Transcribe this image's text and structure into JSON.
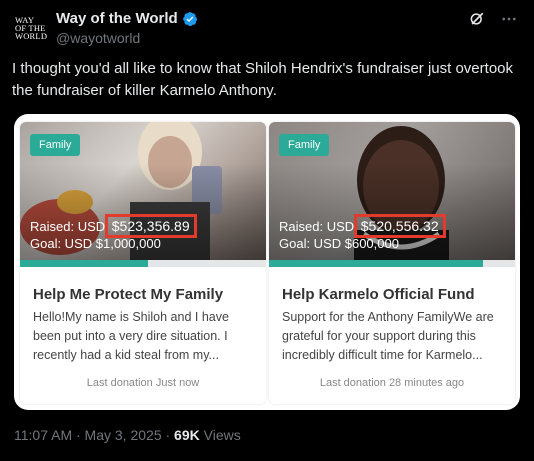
{
  "account": {
    "avatar_lines": [
      "Way",
      "of the",
      "World"
    ],
    "display_name": "Way of the World",
    "handle": "@wayotworld",
    "verified_color": "#1d9bf0"
  },
  "header_icons": [
    "grok-icon",
    "more-icon"
  ],
  "tweet": {
    "text": "I thought you'd all like to know that Shiloh Hendrix's fundraiser just overtook the fundraiser of killer Karmelo Anthony."
  },
  "fundraisers": [
    {
      "tag": "Family",
      "raised_label": "Raised: USD",
      "raised_amount": "$523,356.89",
      "goal": "Goal: USD $1,000,000",
      "progress": 0.52,
      "title": "Help Me Protect My Family",
      "description": "Hello!My name is Shiloh and I have been put into a very dire situation. I recently had a kid steal from my...",
      "last_donation": "Last donation Just now"
    },
    {
      "tag": "Family",
      "raised_label": "Raised: USD",
      "raised_amount": "$520,556.32",
      "goal": "Goal: USD $600,000",
      "progress": 0.87,
      "title": "Help Karmelo Official Fund",
      "description": "Support for the Anthony FamilyWe are grateful for your support during this incredibly difficult time for Karmelo...",
      "last_donation": "Last donation 28 minutes ago"
    }
  ],
  "meta": {
    "time_date": "11:07 AM · May 3, 2025 · ",
    "views_count": "69K",
    "views_label": " Views"
  },
  "colors": {
    "accent": "#2aaa97",
    "highlight": "#e23b2b"
  }
}
